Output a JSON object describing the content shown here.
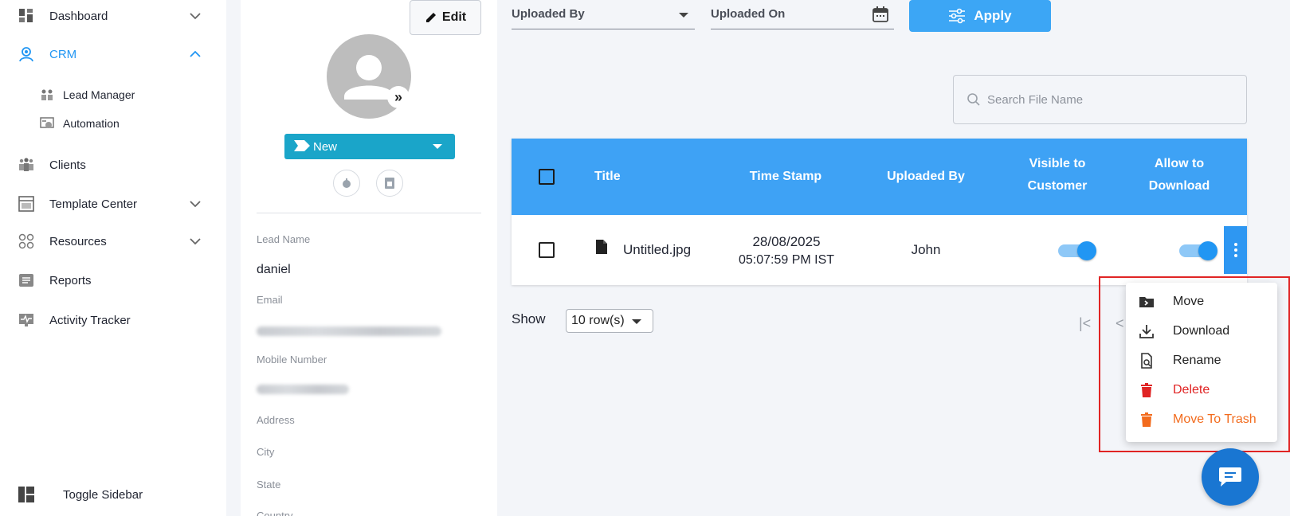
{
  "sidebar": {
    "items": [
      {
        "label": "Dashboard"
      },
      {
        "label": "CRM"
      },
      {
        "label": "Lead Manager"
      },
      {
        "label": "Automation"
      },
      {
        "label": "Clients"
      },
      {
        "label": "Template Center"
      },
      {
        "label": "Resources"
      },
      {
        "label": "Reports"
      },
      {
        "label": "Activity Tracker"
      }
    ],
    "toggle_label": "Toggle Sidebar",
    "accent_color": "#2196f3"
  },
  "profile": {
    "edit_label": "Edit",
    "status": "New",
    "fields": [
      {
        "label": "Lead Name",
        "value": "daniel"
      },
      {
        "label": "Email"
      },
      {
        "label": "Mobile Number"
      },
      {
        "label": "Address"
      },
      {
        "label": "City"
      },
      {
        "label": "State"
      },
      {
        "label": "Country"
      }
    ]
  },
  "filters": {
    "uploaded_by": "Uploaded By",
    "uploaded_on": "Uploaded On",
    "apply_label": "Apply"
  },
  "search": {
    "placeholder": "Search File Name"
  },
  "table": {
    "headers": {
      "title": "Title",
      "timestamp": "Time Stamp",
      "uploaded_by": "Uploaded By",
      "visible_line1": "Visible to",
      "visible_line2": "Customer",
      "download_line1": "Allow to",
      "download_line2": "Download"
    },
    "rows": [
      {
        "title": "Untitled.jpg",
        "date": "28/08/2025",
        "time": "05:07:59 PM IST",
        "uploaded_by": "John",
        "visible_to_customer": true,
        "allow_download": true
      }
    ],
    "header_color": "#3ea2f5"
  },
  "pagination": {
    "show_label": "Show",
    "rows_option": "10 row(s)"
  },
  "context_menu": {
    "items": [
      {
        "label": "Move",
        "color": "#222222"
      },
      {
        "label": "Download",
        "color": "#222222"
      },
      {
        "label": "Rename",
        "color": "#222222"
      },
      {
        "label": "Delete",
        "color": "#e02424"
      },
      {
        "label": "Move To Trash",
        "color": "#f26b1d"
      }
    ]
  }
}
